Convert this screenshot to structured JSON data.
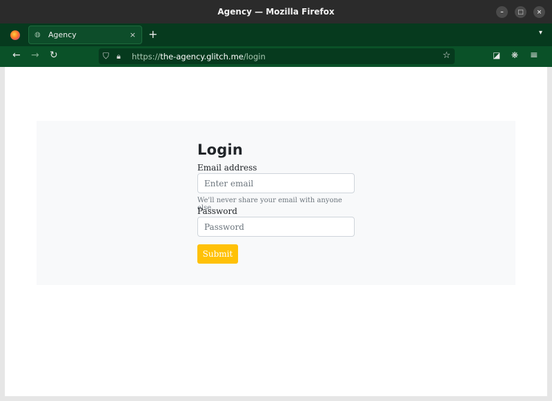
{
  "window": {
    "title": "Agency — Mozilla Firefox",
    "controls": {
      "minimize": "–",
      "maximize": "□",
      "close": "×"
    }
  },
  "tabs": [
    {
      "title": "Agency",
      "close": "×",
      "icon": "globe-icon"
    }
  ],
  "tabstrip": {
    "new_tab": "+",
    "list_all": "⌄"
  },
  "navbar": {
    "back": "←",
    "forward": "→",
    "reload": "↻",
    "url_scheme": "https://",
    "url_host": "the-agency.glitch.me",
    "url_path": "/login",
    "bookmark_star": "☆",
    "pocket": "◪",
    "extensions": "❋",
    "menu": "≡"
  },
  "page": {
    "heading": "Login",
    "email_label": "Email address",
    "email_placeholder": "Enter email",
    "email_value": "",
    "email_help": "We'll never share your email with anyone else.",
    "password_label": "Password",
    "password_placeholder": "Password",
    "password_value": "",
    "submit_label": "Submit"
  },
  "colors": {
    "toolbar_green": "#0a5128",
    "tabstrip_green": "#063a1e",
    "submit_yellow": "#ffc107",
    "jumbotron_bg": "#f8f9fa"
  }
}
